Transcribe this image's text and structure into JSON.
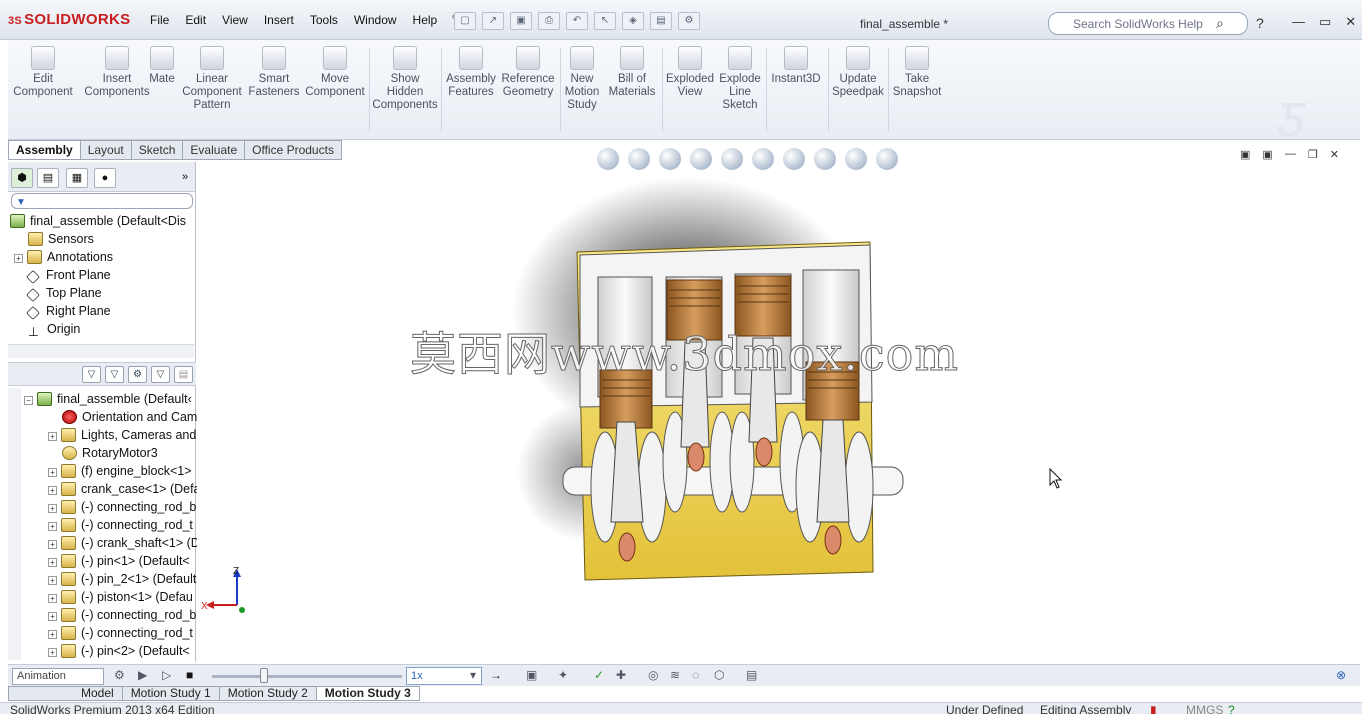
{
  "app": {
    "logo_prefix": "3S",
    "logo_text": "SOLIDWORKS",
    "document_title": "final_assemble *",
    "search_placeholder": "Search SolidWorks Help"
  },
  "menu": [
    "File",
    "Edit",
    "View",
    "Insert",
    "Tools",
    "Window",
    "Help"
  ],
  "ribbon_tools": [
    {
      "label": "Edit\nComponent",
      "icon": "edit-component-icon"
    },
    {
      "label": "Insert\nComponents",
      "icon": "insert-components-icon"
    },
    {
      "label": "Mate",
      "icon": "mate-icon"
    },
    {
      "label": "Linear\nComponent\nPattern",
      "icon": "linear-pattern-icon"
    },
    {
      "label": "Smart\nFasteners",
      "icon": "smart-fasteners-icon"
    },
    {
      "label": "Move\nComponent",
      "icon": "move-component-icon"
    },
    {
      "label": "Show\nHidden\nComponents",
      "icon": "show-hidden-icon"
    },
    {
      "label": "Assembly\nFeatures",
      "icon": "assembly-features-icon"
    },
    {
      "label": "Reference\nGeometry",
      "icon": "reference-geometry-icon"
    },
    {
      "label": "New\nMotion\nStudy",
      "icon": "motion-study-icon"
    },
    {
      "label": "Bill of\nMaterials",
      "icon": "bom-icon"
    },
    {
      "label": "Exploded\nView",
      "icon": "exploded-view-icon"
    },
    {
      "label": "Explode\nLine\nSketch",
      "icon": "explode-line-icon"
    },
    {
      "label": "Instant3D",
      "icon": "instant3d-icon"
    },
    {
      "label": "Update\nSpeedpak",
      "icon": "speedpak-icon"
    },
    {
      "label": "Take\nSnapshot",
      "icon": "snapshot-icon"
    }
  ],
  "cm_tabs": [
    "Assembly",
    "Layout",
    "Sketch",
    "Evaluate",
    "Office Products"
  ],
  "feature_tree": {
    "root": "final_assemble  (Default<Dis",
    "items": [
      "Sensors",
      "Annotations",
      "Front Plane",
      "Top Plane",
      "Right Plane",
      "Origin"
    ]
  },
  "motion_tree": {
    "items": [
      "final_assemble  (Default‹",
      "Orientation and Cam",
      "Lights, Cameras and",
      "RotaryMotor3",
      "(f) engine_block<1>",
      "crank_case<1>  (Defa",
      "(-) connecting_rod_b",
      "(-) connecting_rod_t",
      "(-) crank_shaft<1>  (D",
      "(-) pin<1>  (Default<",
      "(-) pin_2<1>  (Default",
      "(-) piston<1>  (Defau",
      "(-) connecting_rod_b",
      "(-) connecting_rod_t",
      "(-) pin<2>  (Default<"
    ]
  },
  "watermark": "莫西网www.3dmox.com",
  "motion_bar": {
    "study_type": "Animation",
    "speed": "1x"
  },
  "bottom_tabs": [
    "Model",
    "Motion Study 1",
    "Motion Study 2",
    "Motion Study 3"
  ],
  "status": {
    "edition": "SolidWorks Premium 2013 x64 Edition",
    "defined": "Under Defined",
    "editing": "Editing Assembly",
    "units": "MMGS"
  },
  "triad": {
    "z": "Z",
    "x": "X"
  }
}
